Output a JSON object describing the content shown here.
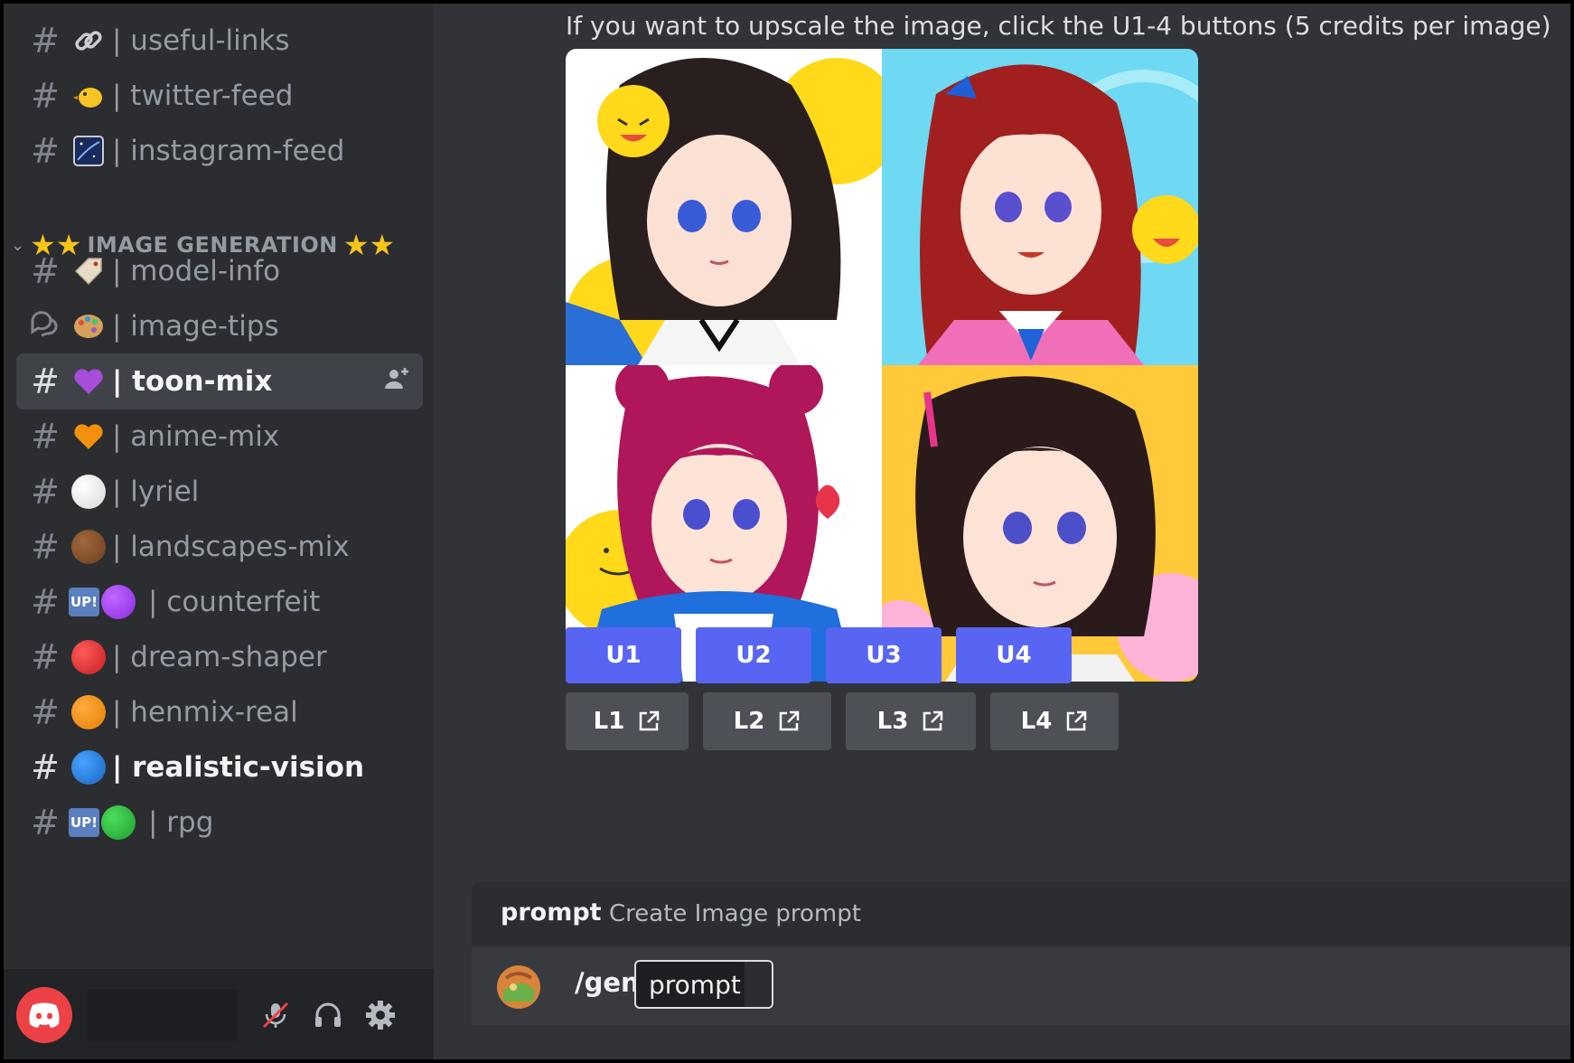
{
  "channels": [
    {
      "name": "| useful-links",
      "icon": "link-icon",
      "kind": "text"
    },
    {
      "name": "| twitter-feed",
      "icon": "chick-icon",
      "kind": "text"
    },
    {
      "name": "| instagram-feed",
      "icon": "night-sky-icon",
      "kind": "text"
    },
    {
      "name": "| model-info",
      "icon": "tag-icon",
      "kind": "text"
    },
    {
      "name": "| image-tips",
      "icon": "palette-icon",
      "kind": "forum"
    },
    {
      "name": "| toon-mix",
      "icon": "purple-heart-icon",
      "kind": "text",
      "selected": true
    },
    {
      "name": "| anime-mix",
      "icon": "orange-heart-icon",
      "kind": "text"
    },
    {
      "name": "| lyriel",
      "icon": "white-circle-icon",
      "kind": "text"
    },
    {
      "name": "| landscapes-mix",
      "icon": "brown-circle-icon",
      "kind": "text"
    },
    {
      "name": "| counterfeit",
      "icon": "up-purple-circle-icon",
      "kind": "text"
    },
    {
      "name": "| dream-shaper",
      "icon": "red-circle-icon",
      "kind": "text"
    },
    {
      "name": "| henmix-real",
      "icon": "orange-circle-icon",
      "kind": "text"
    },
    {
      "name": "| realistic-vision",
      "icon": "blue-circle-icon",
      "kind": "text",
      "unread": true
    },
    {
      "name": "| rpg",
      "icon": "up-green-circle-icon",
      "kind": "text"
    }
  ],
  "category": {
    "label": "IMAGE GENERATION",
    "stars_left": "★★",
    "stars_right": "★★"
  },
  "up_badge": "UP!",
  "message": {
    "text": "If you want to upscale the image, click the U1-4 buttons  (5 credits per image)"
  },
  "upscale_buttons": [
    "U1",
    "U2",
    "U3",
    "U4"
  ],
  "link_buttons": [
    "L1",
    "L2",
    "L3",
    "L4"
  ],
  "command": {
    "name": "prompt",
    "description": "Create Image prompt"
  },
  "input": {
    "command": "/gen",
    "option": "prompt"
  },
  "colors": {
    "blurple": "#5865f2",
    "sidebar": "#2b2d31",
    "main": "#313338"
  }
}
